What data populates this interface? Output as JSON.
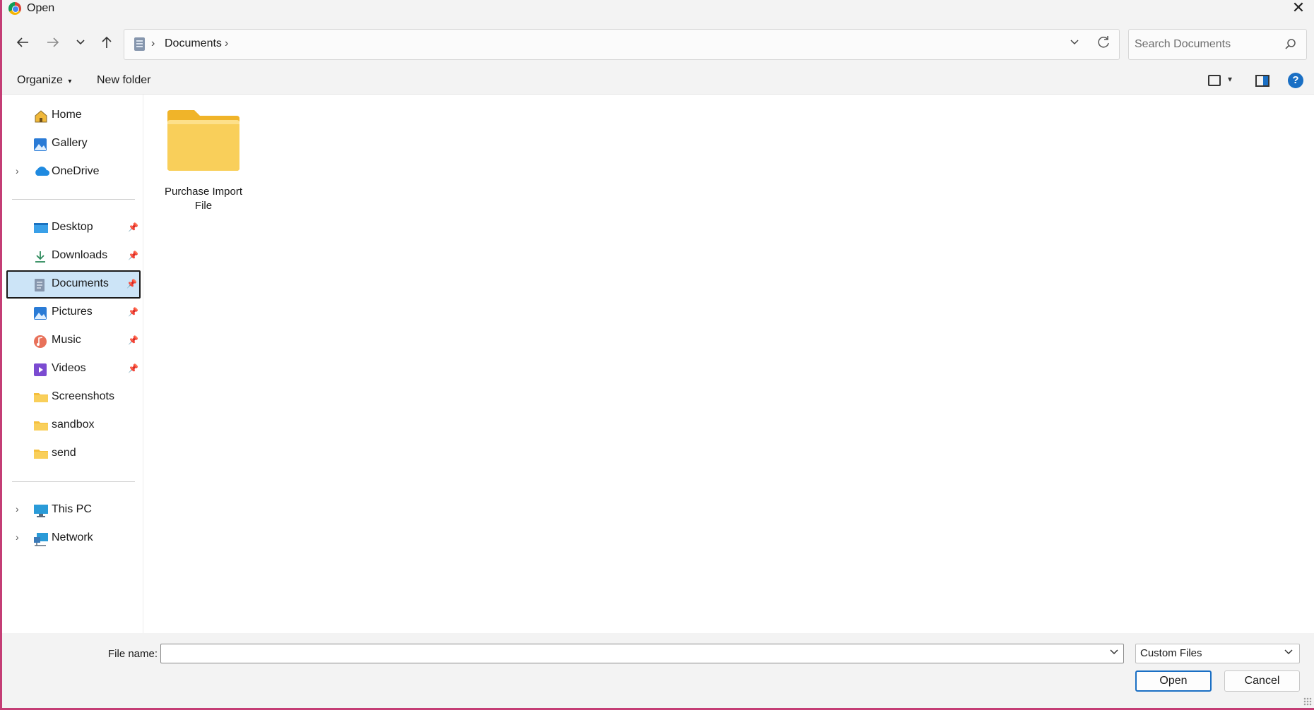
{
  "window": {
    "title": "Open"
  },
  "address": {
    "crumbs": [
      "Documents"
    ]
  },
  "search": {
    "placeholder": "Search Documents"
  },
  "toolbar": {
    "organize_label": "Organize",
    "new_folder_label": "New folder"
  },
  "sidebar": {
    "items": [
      {
        "label": "Home"
      },
      {
        "label": "Gallery"
      },
      {
        "label": "OneDrive"
      },
      {
        "label": "Desktop"
      },
      {
        "label": "Downloads"
      },
      {
        "label": "Documents"
      },
      {
        "label": "Pictures"
      },
      {
        "label": "Music"
      },
      {
        "label": "Videos"
      },
      {
        "label": "Screenshots"
      },
      {
        "label": "sandbox"
      },
      {
        "label": "send"
      },
      {
        "label": "This PC"
      },
      {
        "label": "Network"
      }
    ]
  },
  "content": {
    "folders": [
      {
        "name": "Purchase Import File"
      }
    ]
  },
  "footer": {
    "file_name_label": "File name:",
    "file_name_value": "",
    "file_type": "Custom Files",
    "open_label": "Open",
    "cancel_label": "Cancel"
  },
  "colors": {
    "accent": "#1a6fc4",
    "selection": "#cce4f7",
    "folder": "#f8c94a",
    "window_edge": "#c43d75"
  }
}
